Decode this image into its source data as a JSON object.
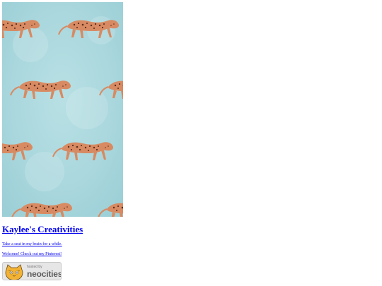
{
  "hero": {
    "alt_description": "",
    "background_color": "#a9d7dd",
    "leopard_color": "#d88a62",
    "spot_color": "#5a2e1f"
  },
  "site": {
    "title": "Kaylee's Creativities"
  },
  "links": {
    "first": "Take a seat in my brain for a while.",
    "second": "Welcome! Check out my Pinterest!"
  },
  "badge": {
    "small_text": "hosted by",
    "big_text": "neocities"
  }
}
